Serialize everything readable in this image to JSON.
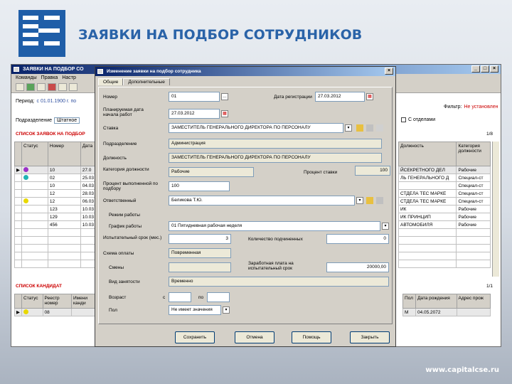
{
  "slide": {
    "title": "ЗАЯВКИ НА ПОДБОР СОТРУДНИКОВ",
    "footer_url": "www.capitalcse.ru",
    "brand_color": "#2a63a8"
  },
  "main_window": {
    "title": "ЗАЯВКИ НА ПОДБОР СО",
    "menu": [
      "Команды",
      "Правка",
      "Настр"
    ],
    "period_label": "Период:",
    "period_value": "с 01.01.1900 г. по",
    "unit_label": "Подразделение",
    "unit_value": "Штатное",
    "filter_label": "Фильтр:",
    "filter_value": "Не установлен",
    "closed_label": "С отделами",
    "list_title": "СПИСОК ЗАЯВОК НА ПОДБОР",
    "list_count": "1/8",
    "columns": [
      "Статус",
      "Номер",
      "Дата"
    ],
    "right_columns": [
      "Должность",
      "Категория должности"
    ],
    "rows": [
      {
        "status_color": "#9b30c8",
        "number": "10",
        "date": "27.0",
        "position": "ЙСЕКРЕТНОГО ДЕЛ",
        "category": "Рабочие"
      },
      {
        "status_color": "#20b4b4",
        "number": "02",
        "date": "25.03",
        "position": "ЛЬ ГЕНЕРАЛЬНОГО Д",
        "category": "Специал-ст"
      },
      {
        "status_color": "",
        "number": "10",
        "date": "04.03",
        "position": "",
        "category": "Специал-ст"
      },
      {
        "status_color": "",
        "number": "12",
        "date": "28.03",
        "position": "СТДЕЛА ТЕС МАРКЕ",
        "category": "Специал-ст"
      },
      {
        "status_color": "#e8d800",
        "number": "12",
        "date": "06.03",
        "position": "СТДЕЛА ТЕС МАРКЕ",
        "category": "Специал-ст"
      },
      {
        "status_color": "",
        "number": "123",
        "date": "10.03",
        "position": "ИК",
        "category": "Рабочие"
      },
      {
        "status_color": "",
        "number": "129",
        "date": "10.03",
        "position": "ИК ПРИНЦИП",
        "category": "Рабочие"
      },
      {
        "status_color": "",
        "number": "456",
        "date": "10.03",
        "position": "АВТОМОБИЛЯ",
        "category": "Рабочие"
      }
    ],
    "candidates_title": "СПИСОК КАНДИДАТ",
    "candidates_count": "1/1",
    "cand_columns": [
      "Статус",
      "Реестр номер",
      "Имени канди"
    ],
    "cand_right_columns": [
      "Пол",
      "Дата рождения",
      "Адрес прож"
    ],
    "cand_rows": [
      {
        "status_color": "#e8d800",
        "number": "08",
        "name": "",
        "sex": "М",
        "birth": "04.05.2072",
        "address": ""
      }
    ]
  },
  "dialog": {
    "title": "Изменение заявки на подбор сотрудника",
    "tabs": [
      "Общие",
      "Дополнительные"
    ],
    "fields": {
      "number_label": "Номер",
      "number_value": "01",
      "reg_date_label": "Дата регистрации",
      "reg_date_value": "27.03.2012",
      "start_date_label": "Планируемая дата начала работ",
      "start_date_value": "27.03.2012",
      "rate_label": "Ставка",
      "rate_value": "ЗАМЕСТИТЕЛЬ ГЕНЕРАЛЬНОГО ДИРЕКТОРА ПО ПЕРСОНАЛУ",
      "division_label": "Подразделение",
      "division_value": "Администрация",
      "position_label": "Должность",
      "position_value": "ЗАМЕСТИТЕЛЬ ГЕНЕРАЛЬНОГО ДИРЕКТОРА ПО ПЕРСОНАЛУ",
      "category_label": "Категория должности",
      "category_value": "Рабочие",
      "percent_label": "Процент ставки",
      "percent_value": "100",
      "replace_label": "Процент выполненной по подбору",
      "replace_value": "100",
      "curator_label": "Ответственный",
      "curator_value": "Беликова Т.Ю.",
      "work_mode_label": "Режим работы",
      "schedule_label": "График работы",
      "schedule_value": "01 Пятидневная рабочая неделя",
      "probation_label": "Испытательный срок (мес.)",
      "probation_value": "3",
      "hours_label": "Количество подчиненных",
      "hours_value": "0",
      "pay_scheme_label": "Схема оплаты",
      "pay_scheme_value": "Повременная",
      "shift_label": "Смены",
      "salary_label": "Заработная плата на испытательный срок",
      "salary_value": "20000,00",
      "work_type_label": "Вид занятости",
      "work_type_value": "Временно",
      "age_label": "Возраст",
      "age_from": "с",
      "age_to": "по",
      "sex_label": "Пол",
      "sex_value": "Не имеет значения"
    },
    "buttons": [
      "Сохранить",
      "Отмена",
      "Помощь",
      "Закрыть"
    ]
  }
}
